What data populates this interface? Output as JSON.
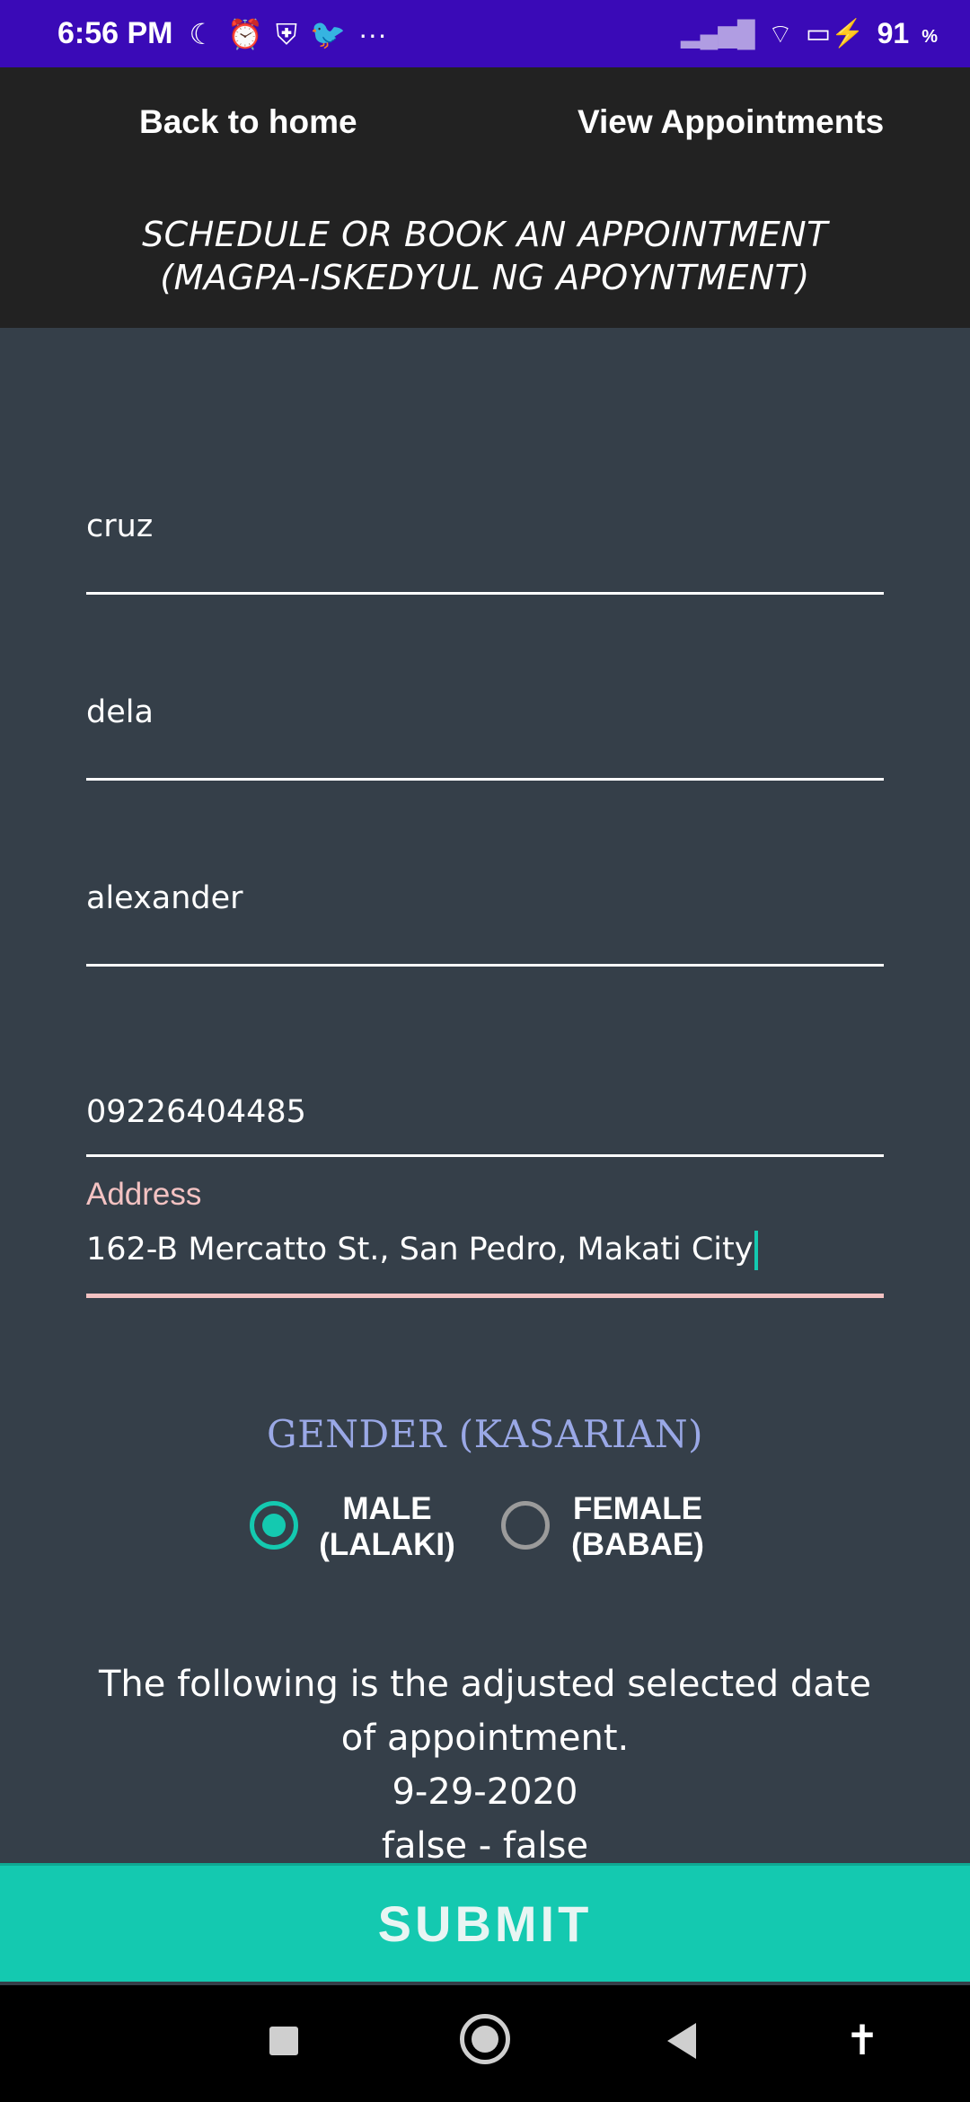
{
  "status_bar": {
    "time": "6:56 PM",
    "left_icons": [
      "moon-icon",
      "alarm-icon",
      "shield-icon",
      "twitter-icon",
      "more-dots-icon"
    ],
    "right_icons": [
      "signal-icon",
      "wifi-icon",
      "battery-charging-icon"
    ],
    "battery_level": "91",
    "battery_unit": "%",
    "bar_color": "#3a0ab7"
  },
  "nav": {
    "back_label": "Back to home",
    "view_label": "View Appointments"
  },
  "page_title": {
    "line1": "SCHEDULE OR BOOK AN APPOINTMENT",
    "line2": "(MAGPA-ISKEDYUL NG APOYNTMENT)"
  },
  "form": {
    "field1_value": "cruz",
    "field2_value": "dela",
    "field3_value": "alexander",
    "phone_value": "09226404485",
    "address_label": "Address",
    "address_value": "162-B Mercatto St., San Pedro, Makati City"
  },
  "gender": {
    "title": "GENDER (KASARIAN)",
    "options": [
      {
        "line1": "MALE",
        "line2": "(LALAKI)",
        "selected": true
      },
      {
        "line1": "FEMALE",
        "line2": "(BABAE)",
        "selected": false
      }
    ]
  },
  "info": {
    "line1": "The following is the adjusted selected date",
    "line2": "of appointment.",
    "date": "9-29-2020",
    "flags": "false - false"
  },
  "submit_label": "SUBMIT",
  "colors": {
    "accent": "#14c9b0",
    "background": "#353f49",
    "header": "#222222",
    "gender_title": "#9aa8e6",
    "address_label": "#f3c2c2"
  }
}
